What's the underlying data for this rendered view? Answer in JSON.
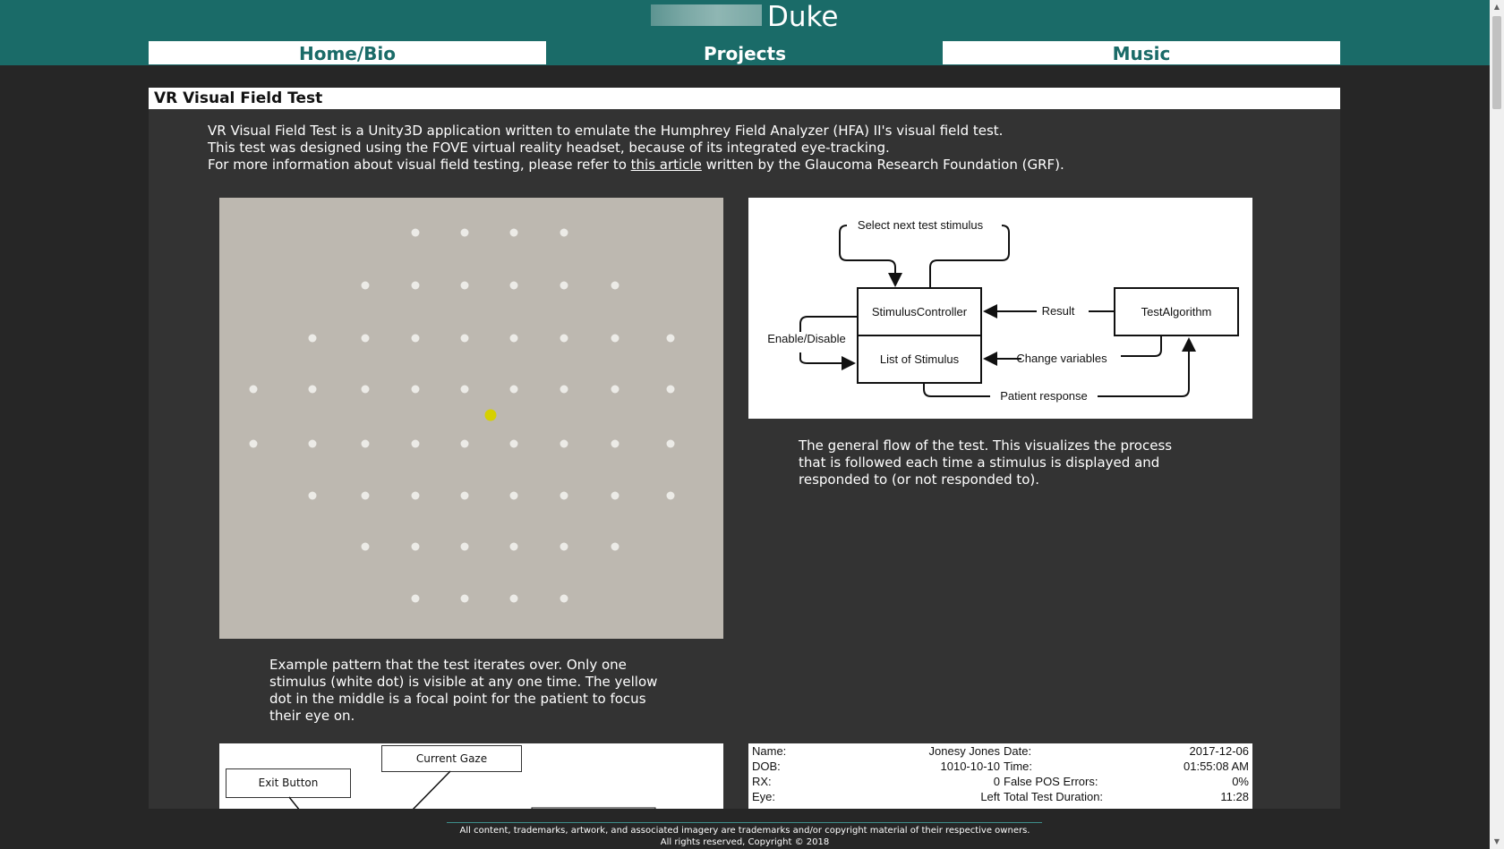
{
  "header": {
    "logo_text": "Duke",
    "nav": [
      {
        "label": "Home/Bio",
        "active": false
      },
      {
        "label": "Projects",
        "active": true
      },
      {
        "label": "Music",
        "active": false
      }
    ],
    "brand_color": "#1a6b68"
  },
  "main": {
    "section_title": "VR Visual Field Test",
    "intro": {
      "line1": "VR Visual Field Test is a Unity3D application written to emulate the Humphrey Field Analyzer (HFA) II's visual field test.",
      "line2": "This test was designed using the FOVE virtual reality headset, because of its integrated eye-tracking.",
      "line3_before": "For more information about visual field testing, please refer to ",
      "line3_link": "this article",
      "line3_after": " written by the Glaucoma Research Foundation (GRF)."
    },
    "pattern_caption": "Example pattern that the test iterates over. Only one stimulus (white dot) is visible at any one time. The yellow dot in the middle is a focal point for the patient to focus their eye on.",
    "flow_caption": "The general flow of the test. This visualizes the process that is followed each time a stimulus is displayed and responded to (or not responded to).",
    "flow_diagram": {
      "select_next": "Select next test stimulus",
      "stimulus_controller": "StimulusController",
      "list_of_stimulus": "List of Stimulus",
      "test_algorithm": "TestAlgorithm",
      "result": "Result",
      "change_variables": "Change variables",
      "patient_response": "Patient response",
      "enable_disable": "Enable/Disable"
    },
    "gui_labels": {
      "current_gaze": "Current Gaze",
      "exit_button": "Exit Button"
    },
    "report": {
      "rows": [
        {
          "l1": "Name:",
          "v1": "Jonesy Jones",
          "l2": "Date:",
          "v2": "2017-12-06"
        },
        {
          "l1": "DOB:",
          "v1": "1010-10-10",
          "l2": "Time:",
          "v2": "01:55:08 AM"
        },
        {
          "l1": "RX:",
          "v1": "0",
          "l2": "False POS Errors:",
          "v2": "0%"
        },
        {
          "l1": "Eye:",
          "v1": "Left",
          "l2": "Total Test Duration:",
          "v2": "11:28"
        }
      ]
    }
  },
  "footer": {
    "line1": "All content, trademarks, artwork, and associated imagery are trademarks and/or copyright material of their respective owners.",
    "line2": "All rights reserved, Copyright © 2018"
  }
}
